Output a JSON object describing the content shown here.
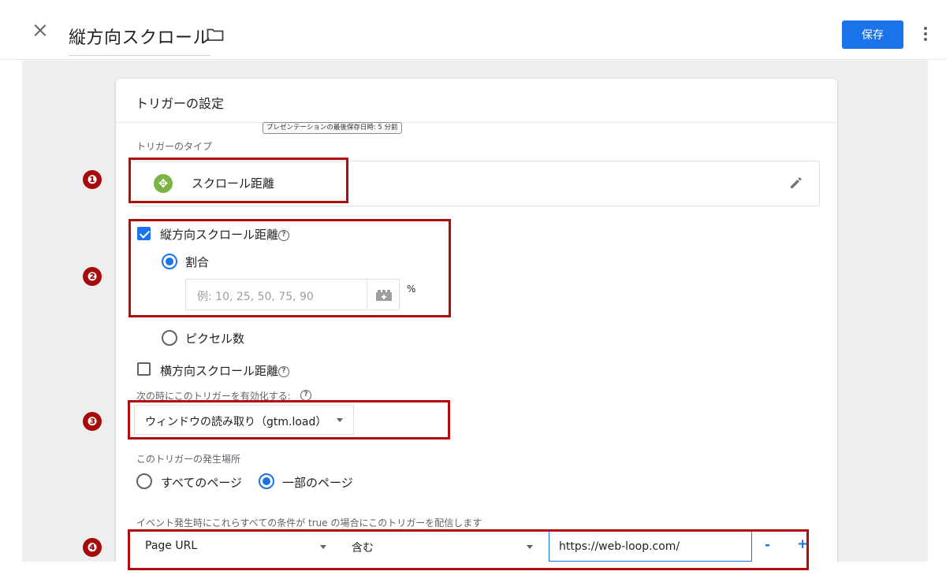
{
  "header": {
    "title": "縦方向スクロール",
    "save_label": "保存"
  },
  "card": {
    "title": "トリガーの設定",
    "tooltip": "プレゼンテーションの最後保存日時: 5 分前",
    "trigger_type_label": "トリガーのタイプ",
    "trigger_type_name": "スクロール距離",
    "vertical_label": "縦方向スクロール距離",
    "ratio_label": "割合",
    "ratio_placeholder": "例: 10, 25, 50, 75, 90",
    "percent_unit": "%",
    "pixels_label": "ピクセル数",
    "horizontal_label": "横方向スクロール距離",
    "enable_when_label": "次の時にこのトリガーを有効化する:",
    "enable_when_value": "ウィンドウの読み取り（gtm.load）",
    "fire_on_label": "このトリガーの発生場所",
    "fire_all_pages": "すべてのページ",
    "fire_some_pages": "一部のページ",
    "condition_label": "イベント発生時にこれらすべての条件が true の場合にこのトリガーを配信します",
    "condition": {
      "variable": "Page URL",
      "operator": "含む",
      "value": "https://web-loop.com/"
    },
    "minus": "-",
    "plus": "+"
  },
  "annotations": {
    "markers": [
      "❶",
      "❷",
      "❸",
      "❹"
    ]
  },
  "icons": {
    "close": "close-icon",
    "folder": "folder-icon",
    "more": "more-vert-icon",
    "scroll_type": "scroll-depth-icon",
    "edit": "pencil-icon",
    "help": "help-icon",
    "variable": "variable-brick-icon",
    "dropdown": "caret-down-icon"
  },
  "colors": {
    "primary": "#1a73e8",
    "annotation_red": "#b10d0d",
    "scroll_icon_green": "#7cb342",
    "canvas_gray": "#eeeeee"
  }
}
